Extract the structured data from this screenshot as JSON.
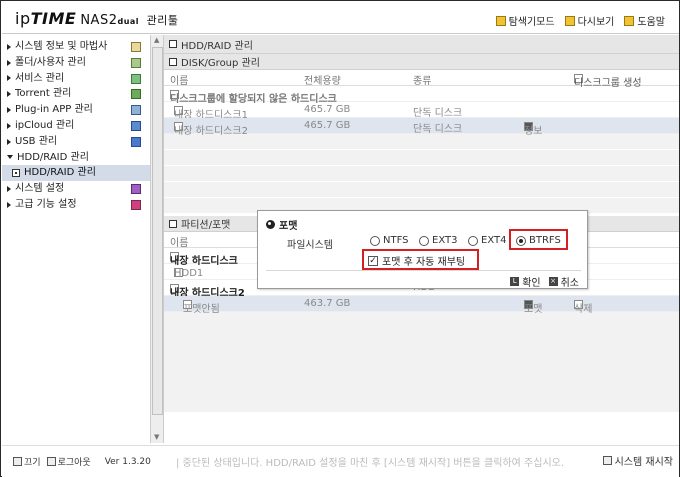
{
  "header": {
    "logo_ip": "ip",
    "logo_time": "TIME",
    "logo_nas": "NAS2",
    "logo_dual": "dual",
    "logo_mgr": "관리툴",
    "buttons": [
      {
        "label": "탐색기모드",
        "icon": "explorer-icon"
      },
      {
        "label": "다시보기",
        "icon": "refresh-icon"
      },
      {
        "label": "도움말",
        "icon": "help-icon"
      }
    ]
  },
  "nav": {
    "items": [
      {
        "label": "시스템 정보 및 마법사",
        "icon": "chart-icon"
      },
      {
        "label": "폴더/사용자 관리",
        "icon": "folder-user-icon"
      },
      {
        "label": "서비스 관리",
        "icon": "service-icon"
      },
      {
        "label": "Torrent 관리",
        "icon": "torrent-icon"
      },
      {
        "label": "Plug-in APP 관리",
        "icon": "plugin-icon"
      },
      {
        "label": "ipCloud 관리",
        "icon": "cloud-icon"
      },
      {
        "label": "USB 관리",
        "icon": "usb-icon"
      },
      {
        "label": "HDD/RAID 관리",
        "icon": ""
      },
      {
        "label": "시스템 설정",
        "icon": "settings-icon"
      },
      {
        "label": "고급 기능 설정",
        "icon": "advanced-icon"
      }
    ],
    "sub_item": "HDD/RAID 관리"
  },
  "left_footer": {
    "power": "끄기",
    "logout": "로그아웃",
    "version": "Ver 1.3.20"
  },
  "main": {
    "title": "HDD/RAID 관리",
    "disk_group": {
      "title": "DISK/Group 관리",
      "columns": {
        "name": "이름",
        "size": "전체용량",
        "type": "종류",
        "create": "디스크그룹 생성"
      },
      "group_header": "디스크그룹에 할당되지 않은 하드디스크",
      "rows": [
        {
          "name": "내장 하드디스크1",
          "size": "465.7 GB",
          "type": "단독 디스크",
          "action": ""
        },
        {
          "name": "내장 하드디스크2",
          "size": "465.7 GB",
          "type": "단독 디스크",
          "action": "정보"
        }
      ]
    },
    "partition": {
      "title": "파티션/포맷",
      "columns": {
        "name": "이름"
      },
      "rows": [
        {
          "name": "내장 하드디스크",
          "size": "",
          "type": ""
        },
        {
          "name": "HDD1",
          "size": "",
          "type": ""
        },
        {
          "name": "내장 하드디스크2",
          "size": "",
          "type": "HDD"
        },
        {
          "name": "포맷안됨",
          "size": "463.7 GB",
          "format": "포맷",
          "delete": "삭제"
        }
      ]
    }
  },
  "main_footer": {
    "text": "| 중단된 상태입니다.     HDD/RAID 설정을 마친 후 [시스템 재시작] 버튼을 클릭하여 주십시오.",
    "restart": "시스템 재시작"
  },
  "dialog": {
    "title": "포맷",
    "fs_label": "파일시스템",
    "options": [
      "NTFS",
      "EXT3",
      "EXT4",
      "BTRFS"
    ],
    "selected": "BTRFS",
    "reboot_label": "포맷 후 자동 재부팅",
    "reboot_checked": true,
    "ok": "확인",
    "cancel": "취소",
    "highlight_color": "#d42020"
  }
}
